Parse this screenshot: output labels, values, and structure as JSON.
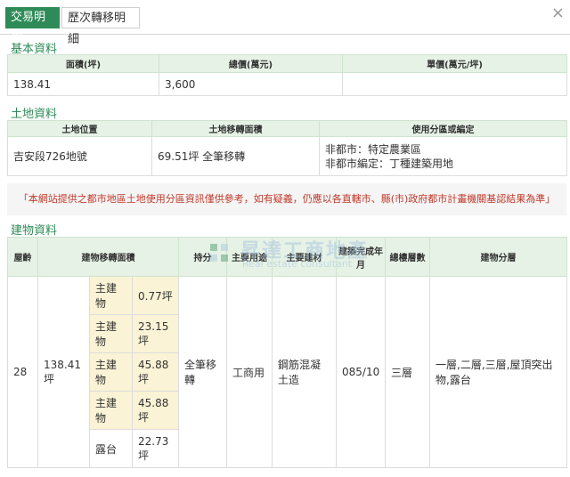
{
  "tabs": {
    "active": "交易明細",
    "inactive": "歷次轉移明細",
    "close": "×"
  },
  "basic": {
    "title": "基本資料",
    "headers": [
      "面積(坪)",
      "總價(萬元)",
      "單價(萬元/坪)"
    ],
    "values": [
      "138.41",
      "3,600",
      ""
    ]
  },
  "land": {
    "title": "土地資料",
    "headers": [
      "土地位置",
      "土地移轉面積",
      "使用分區或編定"
    ],
    "location": "吉安段726地號",
    "area": "69.51坪 全筆移轉",
    "zone_line1": "非都市：特定農業區",
    "zone_line2": "非都市編定：丁種建築用地"
  },
  "notice": "「本網站提供之都市地區土地使用分區資訊僅供參考，如有疑義，仍應以各直轄市、縣(市)政府都市計畫機關基認結果為準」",
  "building": {
    "title": "建物資料",
    "headers": {
      "age": "屋齡",
      "area": "建物移轉面積",
      "share": "持分",
      "use": "主要用途",
      "material": "主要建材",
      "completed": "建築完成年月",
      "floors": "總樓層數",
      "floor_split": "建物分層"
    },
    "row": {
      "age": "28",
      "area": "138.41坪",
      "share": "全筆移轉",
      "use": "工商用",
      "material": "鋼筋混凝土造",
      "completed": "085/10",
      "floors": "三層",
      "floor_split": "一層,二層,三層,屋頂突出物,露台"
    },
    "sub_items": [
      {
        "label": "主建物",
        "value": "0.77坪",
        "highlight": true
      },
      {
        "label": "主建物",
        "value": "23.15坪",
        "highlight": true
      },
      {
        "label": "主建物",
        "value": "45.88坪",
        "highlight": true
      },
      {
        "label": "主建物",
        "value": "45.88坪",
        "highlight": true
      },
      {
        "label": "露台",
        "value": "22.73坪",
        "highlight": false
      }
    ]
  },
  "watermark": {
    "title": "昇達工商地產",
    "subtitle": "Real estate consultant"
  }
}
